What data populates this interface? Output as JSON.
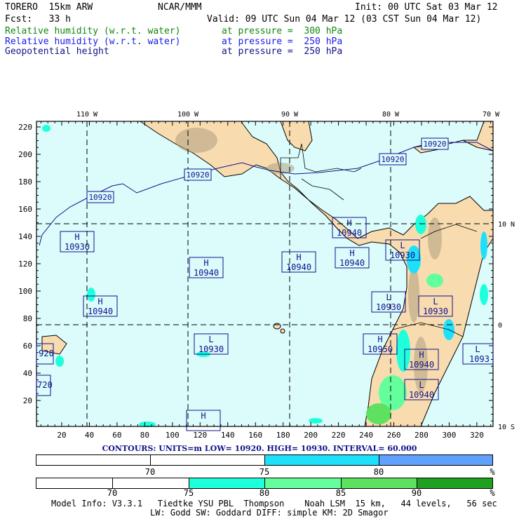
{
  "header": {
    "model": "TORERO  15km ARW",
    "org": "NCAR/MMM",
    "init": "Init: 00 UTC Sat 03 Mar 12",
    "fcst": "Fcst:   33 h",
    "valid": "Valid: 09 UTC Sun 04 Mar 12 (03 CST Sun 04 Mar 12)",
    "fields": [
      {
        "name": "Relative humidity (w.r.t. water)",
        "level": "at pressure =  300 hPa",
        "color": "#118811"
      },
      {
        "name": "Relative humidity (w.r.t. water)",
        "level": "at pressure =  250 hPa",
        "color": "#1a1aee"
      },
      {
        "name": "Geopotential height",
        "level": "at pressure =  250 hPa",
        "color": "#11118a"
      }
    ]
  },
  "chart_data": {
    "type": "map-contour",
    "x_ticks": [
      "20",
      "40",
      "60",
      "80",
      "100",
      "120",
      "140",
      "160",
      "180",
      "200",
      "220",
      "240",
      "260",
      "280",
      "300",
      "320"
    ],
    "y_ticks": [
      "20",
      "40",
      "60",
      "80",
      "100",
      "120",
      "140",
      "160",
      "180",
      "200",
      "220"
    ],
    "lon_labels": [
      "110 W",
      "100 W",
      "90 W",
      "80 W",
      "70 W"
    ],
    "lat_labels": [
      "10 N",
      "0",
      "10 S"
    ],
    "contour_labels": [
      "10920",
      "10920",
      "10920",
      "10920"
    ],
    "centers": [
      {
        "type": "H",
        "value": "10930"
      },
      {
        "type": "H",
        "value": "10940"
      },
      {
        "type": "H",
        "value": "10940"
      },
      {
        "type": "H",
        "value": "10940"
      },
      {
        "type": "H",
        "value": "10940"
      },
      {
        "type": "L",
        "value": "10930"
      },
      {
        "type": "H",
        "value": "10940"
      },
      {
        "type": "L",
        "value": "10930"
      },
      {
        "type": "L",
        "value": "10930"
      },
      {
        "type": "L",
        "value": "10930"
      },
      {
        "type": "H",
        "value": "10950"
      },
      {
        "type": "H",
        "value": "10940"
      },
      {
        "type": "L",
        "value": "10940"
      },
      {
        "type": "H",
        "value": ""
      },
      {
        "type": "L",
        "value": "1093"
      },
      {
        "type": "",
        "value": "920"
      },
      {
        "type": "",
        "value": "720"
      }
    ],
    "contours_info": "CONTOURS:  UNITS=m  LOW=  10920.     HIGH=  10930.     INTERVAL=   60.000",
    "colorbar_250": {
      "labels": [
        "70",
        "75",
        "80",
        "%"
      ],
      "colors": [
        "#ffffff",
        "#ffffff",
        "#1ee0fa",
        "#60a0ff"
      ]
    },
    "colorbar_300": {
      "labels": [
        "70",
        "75",
        "80",
        "85",
        "90",
        "%"
      ],
      "colors": [
        "#ffffff",
        "#ffffff",
        "#1effdc",
        "#64ff9c",
        "#5ee060",
        "#20a020"
      ]
    }
  },
  "footer": {
    "line1": "Model Info: V3.3.1   Tiedtke YSU PBL  Thompson    Noah LSM  15 km,   44 levels,   56 sec",
    "line2": "LW: Godd SW: Goddard DIFF: simple KM: 2D Smagor"
  }
}
